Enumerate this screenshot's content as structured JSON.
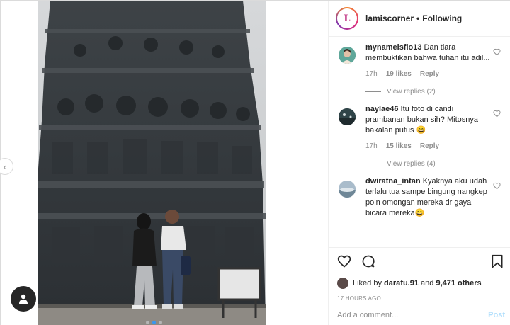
{
  "post": {
    "username": "lamiscorner",
    "follow_status": "Following",
    "separator": "•",
    "logo_letter": "L"
  },
  "comments": [
    {
      "username": "mynameisflo13",
      "text": "Dan tiara membuktikan bahwa tuhan itu adil...",
      "time": "17h",
      "likes": "19 likes",
      "reply": "Reply",
      "view_replies": "View replies (2)"
    },
    {
      "username": "naylae46",
      "text": "Itu foto di candi prambanan bukan sih? Mitosnya bakalan putus 😄",
      "time": "17h",
      "likes": "15 likes",
      "reply": "Reply",
      "view_replies": "View replies (4)"
    },
    {
      "username": "dwiratna_intan",
      "text": "Kyaknya aku udah terlalu tua sampe bingung nangkep poin omongan mereka dr gaya bicara mereka😄"
    }
  ],
  "likes_summary": {
    "prefix": "Liked by",
    "user": "darafu.91",
    "middle": "and",
    "others": "9,471 others"
  },
  "time_ago": "17 HOURS AGO",
  "add_comment": {
    "placeholder": "Add a comment...",
    "post_label": "Post"
  },
  "colors": {
    "accent": "#3897f0",
    "post_disabled": "#b2dffc",
    "muted": "#8e8e8e",
    "text": "#262626"
  },
  "icons": [
    "heart-icon",
    "comment-icon",
    "bookmark-icon",
    "chevron-left-icon",
    "user-icon"
  ]
}
